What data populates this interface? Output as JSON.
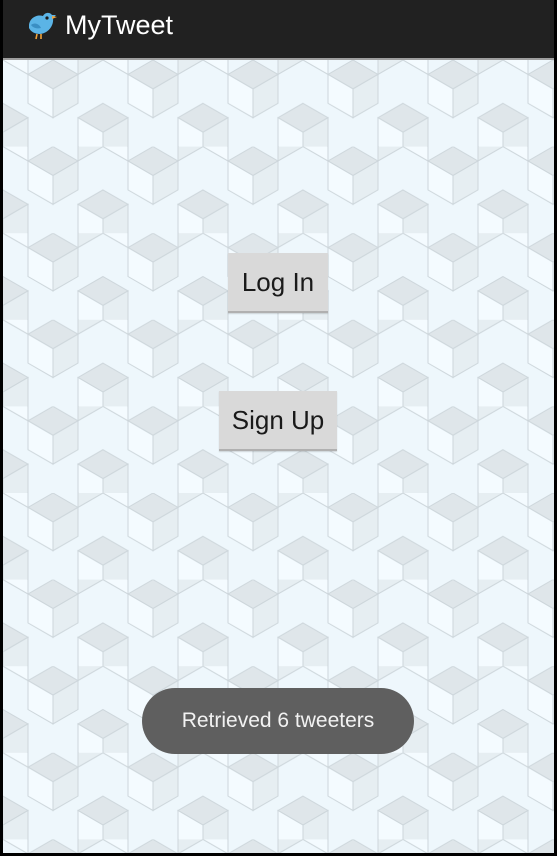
{
  "action_bar": {
    "title": "MyTweet",
    "icon": "bird-icon",
    "background_color": "#212121"
  },
  "main": {
    "login_label": "Log In",
    "signup_label": "Sign Up"
  },
  "toast": {
    "message": "Retrieved 6 tweeters"
  },
  "colors": {
    "button_bg": "#d9d9d9",
    "toast_bg": "#5f5f5f",
    "background": "#eef7fc"
  }
}
